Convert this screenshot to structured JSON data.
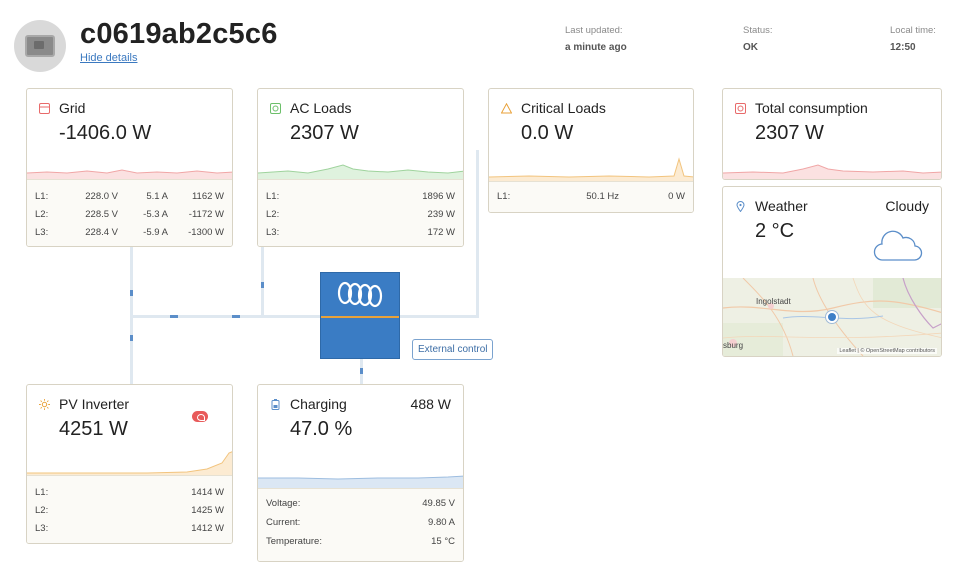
{
  "header": {
    "site_id": "c0619ab2c5c6",
    "hide_details": "Hide details",
    "last_updated_label": "Last updated:",
    "last_updated_value": "a minute ago",
    "status_label": "Status:",
    "status_value": "OK",
    "local_time_label": "Local time:",
    "local_time_value": "12:50"
  },
  "grid": {
    "title": "Grid",
    "value": "-1406.0 W",
    "rows": [
      {
        "label": "L1:",
        "v": "228.0 V",
        "a": "5.1 A",
        "w": "1162 W"
      },
      {
        "label": "L2:",
        "v": "228.5 V",
        "a": "-5.3 A",
        "w": "-1172 W"
      },
      {
        "label": "L3:",
        "v": "228.4 V",
        "a": "-5.9 A",
        "w": "-1300 W"
      }
    ]
  },
  "ac_loads": {
    "title": "AC Loads",
    "value": "2307 W",
    "rows": [
      {
        "label": "L1:",
        "w": "1896 W"
      },
      {
        "label": "L2:",
        "w": "239 W"
      },
      {
        "label": "L3:",
        "w": "172 W"
      }
    ]
  },
  "critical_loads": {
    "title": "Critical Loads",
    "value": "0.0 W",
    "rows": [
      {
        "label": "L1:",
        "hz": "50.1 Hz",
        "w": "0 W"
      }
    ]
  },
  "total_consumption": {
    "title": "Total consumption",
    "value": "2307 W"
  },
  "weather": {
    "title": "Weather",
    "condition": "Cloudy",
    "temperature": "2 °C",
    "map_city_1": "Ingolstadt",
    "map_city_2": "sburg",
    "map_attribution": "Leaflet | © OpenStreetMap contributors"
  },
  "pv_inverter": {
    "title": "PV Inverter",
    "value": "4251 W",
    "rows": [
      {
        "label": "L1:",
        "w": "1414 W"
      },
      {
        "label": "L2:",
        "w": "1425 W"
      },
      {
        "label": "L3:",
        "w": "1412 W"
      }
    ]
  },
  "charging": {
    "title": "Charging",
    "power": "488 W",
    "value": "47.0 %",
    "rows": [
      {
        "label": "Voltage:",
        "value": "49.85 V"
      },
      {
        "label": "Current:",
        "value": "9.80 A"
      },
      {
        "label": "Temperature:",
        "value": "15 °C"
      }
    ]
  },
  "inverter": {
    "external_control": "External control"
  },
  "colors": {
    "grid": "#e86a6a",
    "ac_loads": "#6cbf6a",
    "critical_loads": "#e9a23a",
    "pv": "#e9a23a",
    "charging": "#5b8ec9",
    "inverter": "#3a7cc4"
  }
}
